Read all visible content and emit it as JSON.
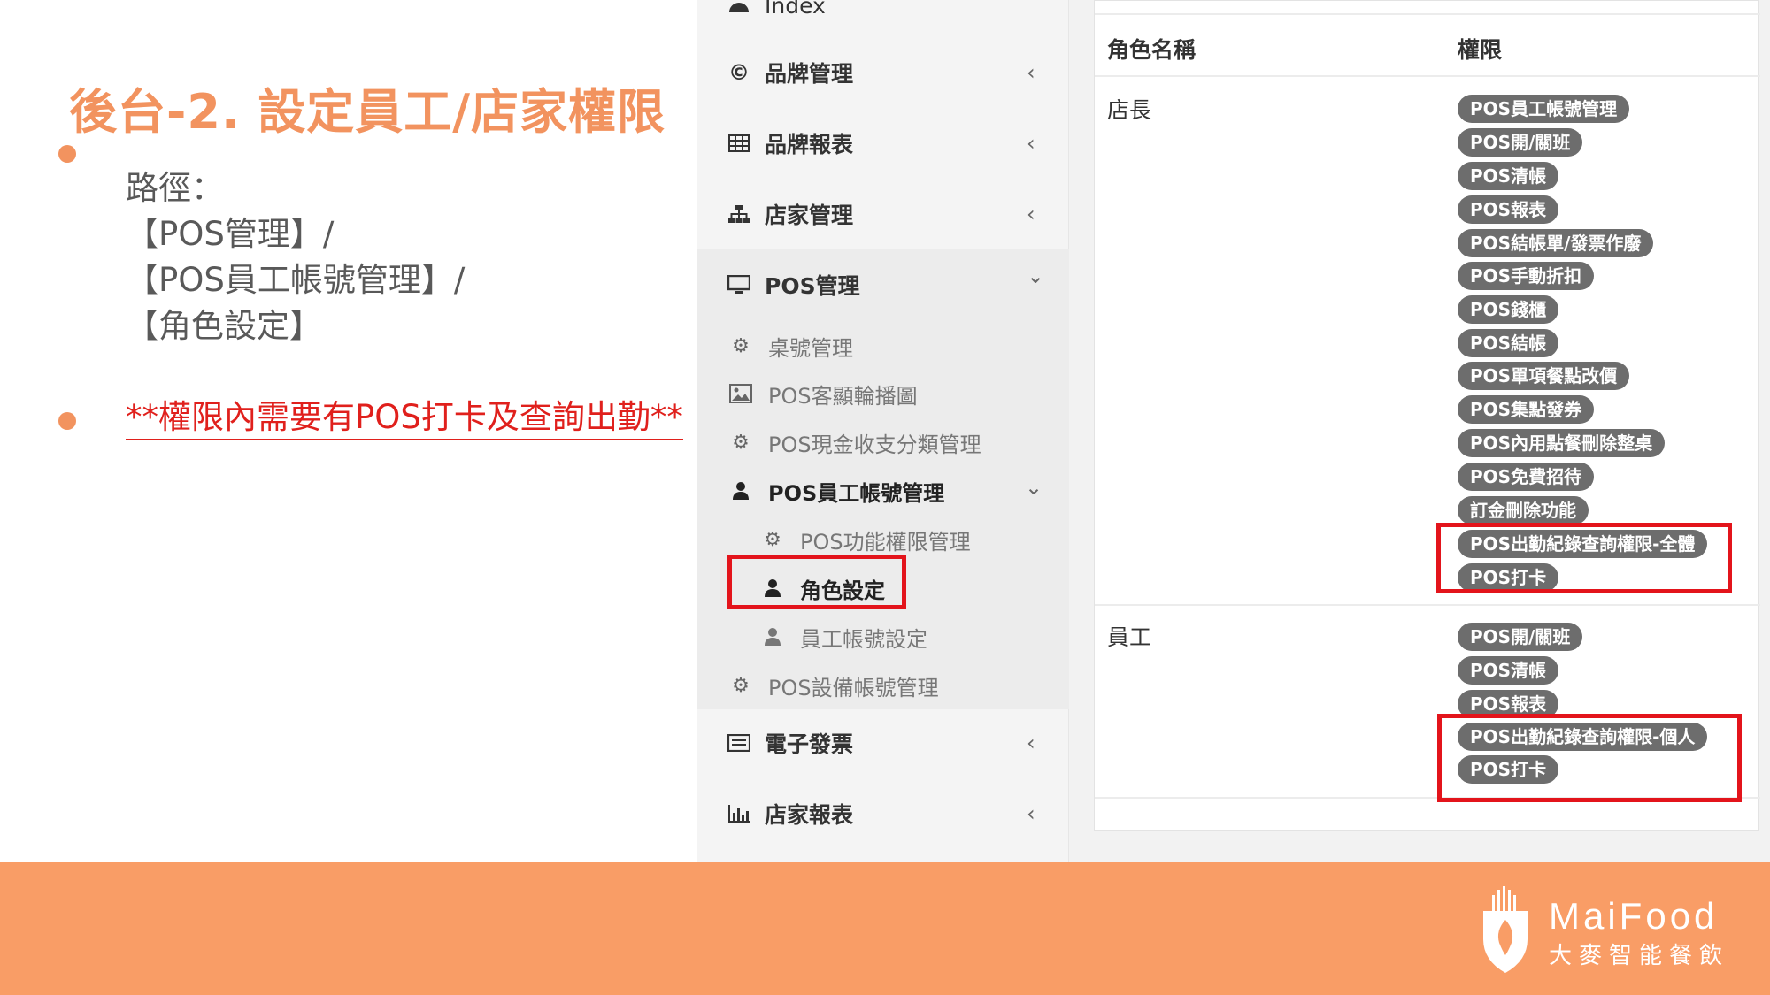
{
  "slide": {
    "title": "後台-2. 設定員工/店家權限",
    "path_lines": [
      "路徑：",
      "【POS管理】/",
      "【POS員工帳號管理】/",
      "【角色設定】"
    ],
    "note": "**權限內需要有POS打卡及查詢出勤**"
  },
  "sidebar": {
    "index_label": "Index",
    "brand_manage": "品牌管理",
    "brand_report": "品牌報表",
    "store_manage": "店家管理",
    "pos_manage": "POS管理",
    "table_manage": "桌號管理",
    "customer_carousel": "POS客顯輪播圖",
    "cash_category": "POS現金收支分類管理",
    "staff_account_manage": "POS員工帳號管理",
    "pos_permission": "POS功能權限管理",
    "role_setting": "角色設定",
    "staff_account_setting": "員工帳號設定",
    "device_account": "POS設備帳號管理",
    "e_invoice": "電子發票",
    "store_report": "店家報表",
    "chevron_left": "‹",
    "chevron_down": "⌄"
  },
  "table": {
    "col_role": "角色名稱",
    "col_permission": "權限",
    "rows": [
      {
        "role": "店長",
        "permissions": [
          "POS員工帳號管理",
          "POS開/關班",
          "POS清帳",
          "POS報表",
          "POS結帳單/發票作廢",
          "POS手動折扣",
          "POS錢櫃",
          "POS結帳",
          "POS單項餐點改價",
          "POS集點發券",
          "POS內用點餐刪除整桌",
          "POS免費招待",
          "訂金刪除功能",
          "POS出勤紀錄查詢權限-全體",
          "POS打卡"
        ]
      },
      {
        "role": "員工",
        "permissions": [
          "POS開/關班",
          "POS清帳",
          "POS報表",
          "POS出勤紀錄查詢權限-個人",
          "POS打卡"
        ]
      }
    ]
  },
  "footer": {
    "brand_en": "MaiFood",
    "brand_zh": "大麥智能餐飲"
  },
  "colors": {
    "accent_orange": "#f2935f",
    "footer_orange": "#f99d66",
    "highlight_red": "#e3141b",
    "note_red": "#e0201c",
    "badge_gray": "#6d6d6d"
  }
}
